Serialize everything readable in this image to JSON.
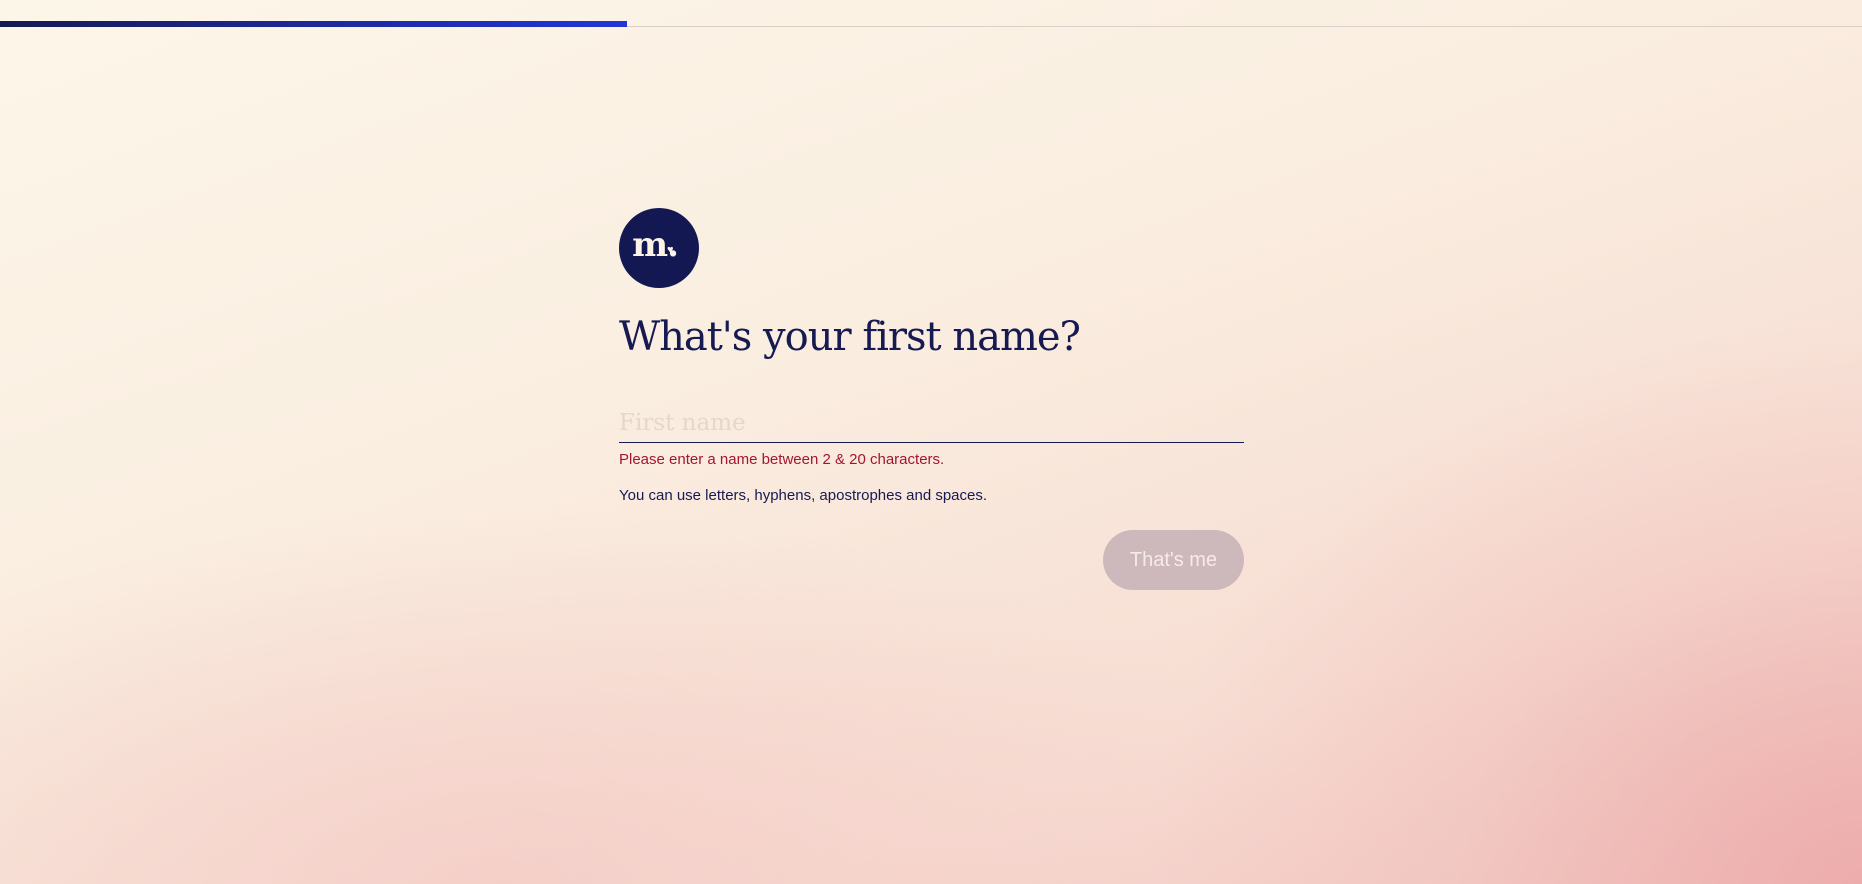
{
  "progress": {
    "fraction": 0.337
  },
  "logo": {
    "letter": "m.",
    "heart": "♥"
  },
  "form": {
    "title": "What's your first name?",
    "first_name_placeholder": "First name",
    "first_name_value": "",
    "error_text": "Please enter a name between 2 & 20 characters.",
    "hint_text": "You can use letters, hyphens, apostrophes and spaces.",
    "submit_label": "That's me"
  },
  "colors": {
    "brand_navy": "#141852",
    "progress_accent": "#2236d6",
    "error_red": "#a3162f",
    "button_disabled": "#cdb8bb"
  }
}
